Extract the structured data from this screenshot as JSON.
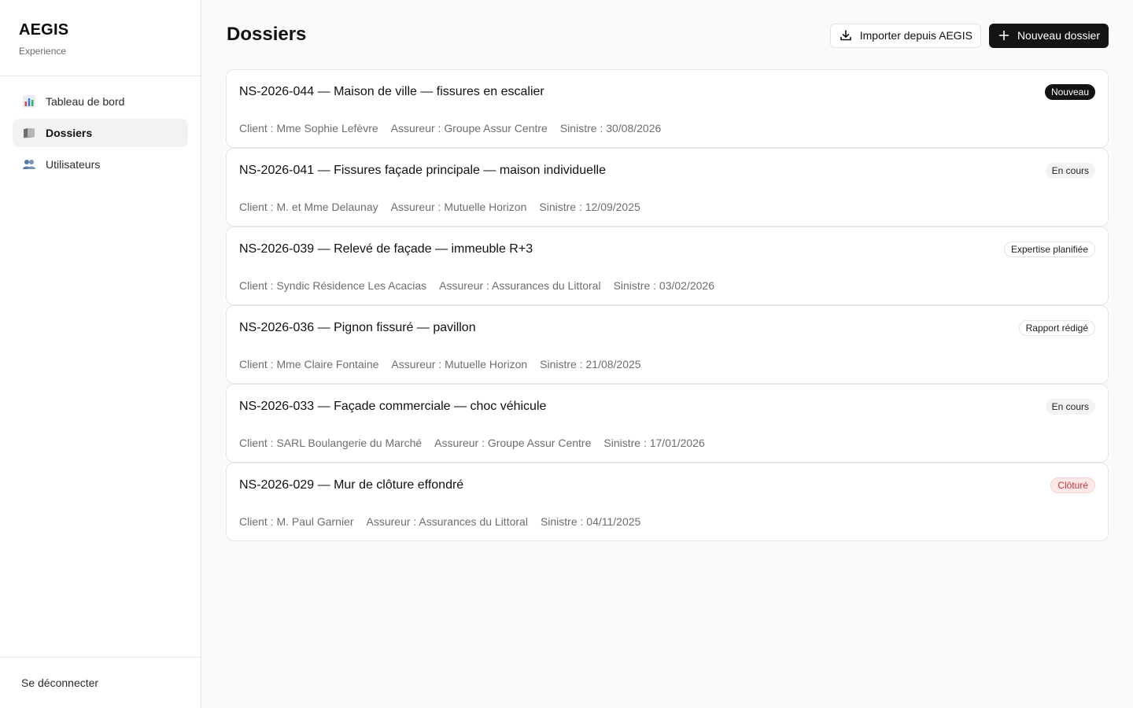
{
  "brand": {
    "title": "AEGIS",
    "subtitle": "Experience"
  },
  "sidebar": {
    "items": [
      {
        "label": "Tableau de bord",
        "icon": "bar-chart-icon"
      },
      {
        "label": "Dossiers",
        "icon": "folder-icon",
        "active": true
      },
      {
        "label": "Utilisateurs",
        "icon": "users-icon"
      }
    ],
    "logout_label": "Se déconnecter"
  },
  "header": {
    "title": "Dossiers",
    "import_label": "Importer depuis AEGIS",
    "new_label": "Nouveau dossier"
  },
  "colors": {
    "accent_dark": "#141414",
    "danger": "#c8343a",
    "danger_bg": "#fde8e8",
    "muted_text": "#6e6e6e",
    "border": "#e5e5e5"
  },
  "dossiers": [
    {
      "title": "NS-2026-044 — Maison de ville — fissures en escalier",
      "client": "Client : Mme Sophie Lefèvre",
      "assureur": "Assureur : Groupe Assur Centre",
      "sinistre": "Sinistre : 30/08/2026",
      "status": "Nouveau",
      "status_style": "dark"
    },
    {
      "title": "NS-2026-041 — Fissures façade principale — maison individuelle",
      "client": "Client : M. et Mme Delaunay",
      "assureur": "Assureur : Mutuelle Horizon",
      "sinistre": "Sinistre : 12/09/2025",
      "status": "En cours",
      "status_style": "light"
    },
    {
      "title": "NS-2026-039 — Relevé de façade — immeuble R+3",
      "client": "Client : Syndic Résidence Les Acacias",
      "assureur": "Assureur : Assurances du Littoral",
      "sinistre": "Sinistre : 03/02/2026",
      "status": "Expertise planifiée",
      "status_style": "outline"
    },
    {
      "title": "NS-2026-036 — Pignon fissuré — pavillon",
      "client": "Client : Mme Claire Fontaine",
      "assureur": "Assureur : Mutuelle Horizon",
      "sinistre": "Sinistre : 21/08/2025",
      "status": "Rapport rédigé",
      "status_style": "outline"
    },
    {
      "title": "NS-2026-033 — Façade commerciale — choc véhicule",
      "client": "Client : SARL Boulangerie du Marché",
      "assureur": "Assureur : Groupe Assur Centre",
      "sinistre": "Sinistre : 17/01/2026",
      "status": "En cours",
      "status_style": "light"
    },
    {
      "title": "NS-2026-029 — Mur de clôture effondré",
      "client": "Client : M. Paul Garnier",
      "assureur": "Assureur : Assurances du Littoral",
      "sinistre": "Sinistre : 04/11/2025",
      "status": "Clôturé",
      "status_style": "red"
    }
  ]
}
